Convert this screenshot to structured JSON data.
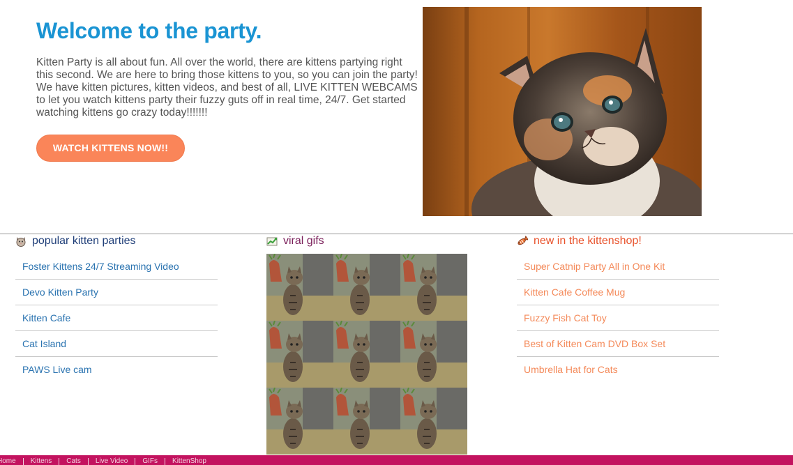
{
  "hero": {
    "title": "Welcome to the party.",
    "text": "Kitten Party is all about fun. All over the world, there are kittens partying right this second. We are here to bring those kittens to you, so you can join the party! We have kitten pictures, kitten videos, and best of all, LIVE KITTEN WEBCAMS to let you watch kittens party their fuzzy guts off in real time, 24/7. Get started watching kittens go crazy today!!!!!!!",
    "cta_label": "WATCH KITTENS NOW!!"
  },
  "columns": {
    "popular": {
      "heading": "popular kitten parties",
      "icon": "cat-face-icon",
      "items": [
        "Foster Kittens 24/7 Streaming Video",
        "Devo Kitten Party",
        "Kitten Cafe",
        "Cat Island",
        "PAWS Live cam"
      ]
    },
    "viral": {
      "heading": "viral gifs",
      "icon": "trending-chart-icon"
    },
    "shop": {
      "heading": "new in the kittenshop!",
      "icon": "fish-icon",
      "items": [
        "Super Catnip Party All in One Kit",
        "Kitten Cafe Coffee Mug",
        "Fuzzy Fish Cat Toy",
        "Best of Kitten Cam DVD Box Set",
        "Umbrella Hat for Cats"
      ]
    }
  },
  "footer": {
    "links": [
      "Home",
      "Kittens",
      "Cats",
      "Live Video",
      "GIFs",
      "KittenShop"
    ]
  },
  "colors": {
    "title_blue": "#1a94d3",
    "cta_orange": "#fa8559",
    "footer_magenta": "#c3135f"
  }
}
